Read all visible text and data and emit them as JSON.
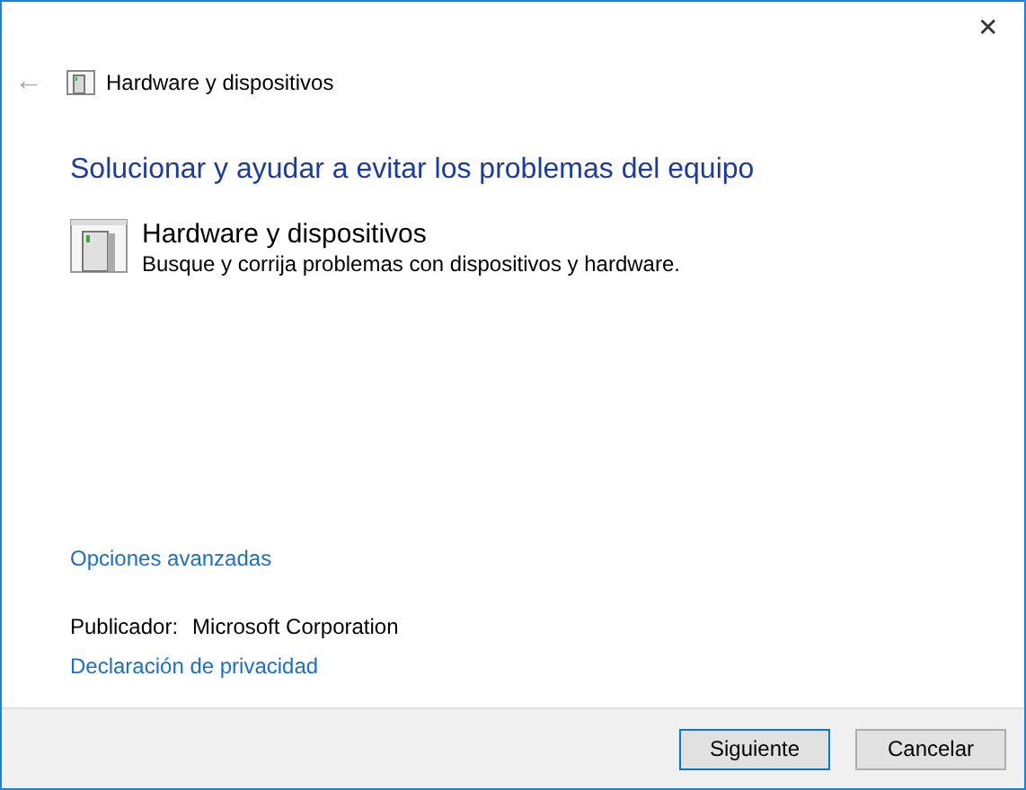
{
  "window": {
    "close": "✕"
  },
  "nav": {
    "back": "←",
    "title": "Hardware y dispositivos"
  },
  "heading": "Solucionar y ayudar a evitar los problemas del equipo",
  "troubleshooter": {
    "title": "Hardware y dispositivos",
    "description": "Busque y corrija problemas con dispositivos y hardware."
  },
  "advanced_link": "Opciones avanzadas",
  "publisher": {
    "label": "Publicador:",
    "value": "Microsoft Corporation"
  },
  "privacy_link": "Declaración de privacidad",
  "buttons": [
    {
      "label": "Siguiente",
      "default": true
    },
    {
      "label": "Cancelar",
      "default": false
    }
  ]
}
